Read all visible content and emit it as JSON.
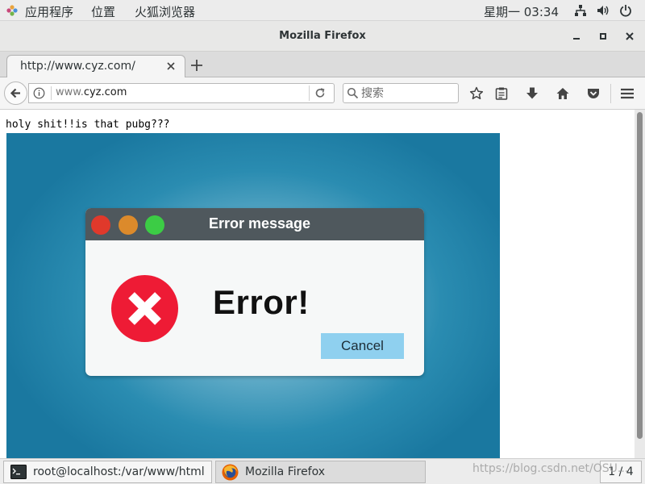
{
  "topbar": {
    "apps_menu": "应用程序",
    "places_menu": "位置",
    "active_app": "火狐浏览器",
    "clock": "星期一 03:34"
  },
  "window": {
    "title": "Mozilla Firefox"
  },
  "tabs": [
    {
      "label": "http://www.cyz.com/"
    }
  ],
  "navbar": {
    "url_prefix": "www.",
    "url_domain": "cyz.com",
    "search_placeholder": "搜索"
  },
  "page": {
    "heading": "holy shit!!is that pubg???",
    "illustration": {
      "window_title": "Error message",
      "error_text": "Error!",
      "button_label": "Cancel",
      "colors": {
        "close_dot": "#e0392b",
        "minimize_dot": "#dc8a2b",
        "maximize_dot": "#3ccc45",
        "error_icon": "#ee1b35",
        "button": "#8fd0ef",
        "background": "#1a78a0"
      }
    }
  },
  "taskbar": {
    "items": [
      {
        "label": "root@localhost:/var/www/html",
        "icon": "terminal-icon"
      },
      {
        "label": "Mozilla Firefox",
        "icon": "firefox-icon"
      }
    ],
    "workspace": "1 / 4"
  },
  "watermark": "https://blog.csdn.net/OSU..."
}
